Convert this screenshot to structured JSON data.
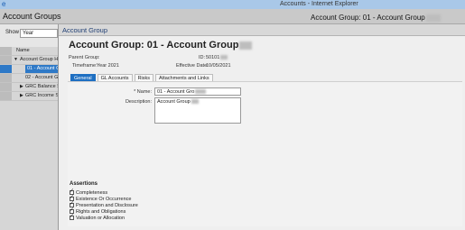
{
  "browser": {
    "title": "Accounts - Internet Explorer"
  },
  "background": {
    "header_title": "Account Groups",
    "header_right": "Account Group: 01 - Account Group",
    "show_label": "Show",
    "show_value": "Year",
    "tree": [
      "Name",
      "Account Group Hi",
      "01 - Account Gr",
      "02 - Account Gro",
      "GRC Balance S",
      "GRC Income St"
    ]
  },
  "modal": {
    "header_title": "Account Group",
    "title": "Account Group: 01 - Account Group",
    "parent_group_label": "Parent Group:",
    "parent_group_value": "",
    "timeframe_label": "Timeframe:",
    "timeframe_value": "Year 2021",
    "id_label": "ID:",
    "id_value": "50101",
    "effective_date_label": "Effective Date:",
    "effective_date_value": "10/05/2021",
    "tabs": [
      "General",
      "GL Accounts",
      "Risks",
      "Attachments and Links"
    ],
    "name_label": "* Name:",
    "name_value": "01 - Account Gro",
    "description_label": "Description:",
    "description_value": "Account Group",
    "assertions_title": "Assertions",
    "assertions": [
      "Completeness",
      "Existence Or Occurrence",
      "Presentation and Disclosure",
      "Rights and Obligations",
      "Valuation or Allocation"
    ]
  },
  "colors": {
    "accent": "#1e6fc2",
    "selection": "#2e79c7",
    "title_text": "#1f3e73"
  }
}
